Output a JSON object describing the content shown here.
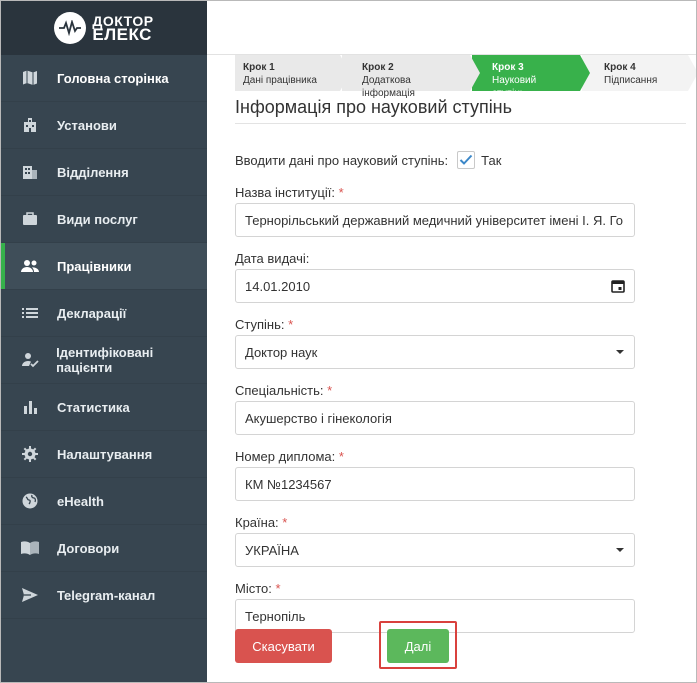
{
  "brand": {
    "line1": "ДОКТОР",
    "line2": "ЕЛЕКС"
  },
  "sidebar": {
    "items": [
      {
        "label": "Головна сторінка",
        "icon": "map-icon"
      },
      {
        "label": "Установи",
        "icon": "building-icon"
      },
      {
        "label": "Відділення",
        "icon": "office-icon"
      },
      {
        "label": "Види послуг",
        "icon": "briefcase-icon"
      },
      {
        "label": "Працівники",
        "icon": "people-icon"
      },
      {
        "label": "Декларації",
        "icon": "list-icon"
      },
      {
        "label": "Ідентифіковані пацієнти",
        "icon": "user-check-icon"
      },
      {
        "label": "Статистика",
        "icon": "bar-chart-icon"
      },
      {
        "label": "Налаштування",
        "icon": "gear-icon"
      },
      {
        "label": "eHealth",
        "icon": "globe-icon"
      },
      {
        "label": "Договори",
        "icon": "book-icon"
      },
      {
        "label": "Telegram-канал",
        "icon": "send-icon"
      }
    ]
  },
  "stepper": [
    {
      "title": "Крок 1",
      "subtitle": "Дані працівника"
    },
    {
      "title": "Крок 2",
      "subtitle": "Додаткова інформація"
    },
    {
      "title": "Крок 3",
      "subtitle": "Науковий ступінь"
    },
    {
      "title": "Крок 4",
      "subtitle": "Підписання"
    }
  ],
  "page": {
    "title": "Інформація про науковий ступінь"
  },
  "form": {
    "enter_degree_label": "Вводити дані про науковий ступінь:",
    "enter_degree_checkbox_label": "Так",
    "institution": {
      "label": "Назва інституції:",
      "value": "Тернорільський державний медичний університет імені І. Я. Го"
    },
    "issue_date": {
      "label": "Дата видачі:",
      "value": "14.01.2010"
    },
    "degree": {
      "label": "Ступінь:",
      "value": "Доктор наук"
    },
    "specialty": {
      "label": "Спеціальність:",
      "value": "Акушерство і гінекологія"
    },
    "diploma": {
      "label": "Номер диплома:",
      "value": "КМ №1234567"
    },
    "country": {
      "label": "Країна:",
      "value": "УКРАЇНА"
    },
    "city": {
      "label": "Місто:",
      "value": "Тернопіль"
    },
    "required_mark": "*"
  },
  "buttons": {
    "cancel": "Скасувати",
    "next": "Далі"
  },
  "colors": {
    "accent_green": "#38b14b",
    "sidebar_bg": "#374550",
    "danger": "#d9534f",
    "success": "#5cb85c",
    "highlight": "#d9413d"
  }
}
